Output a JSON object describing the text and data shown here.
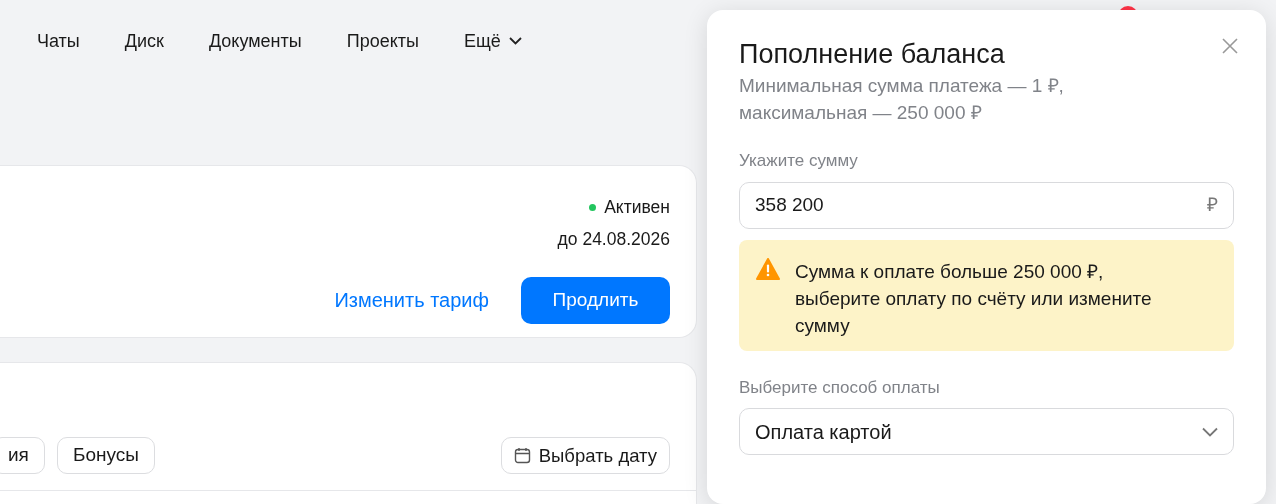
{
  "nav": {
    "items": [
      {
        "label": "Чаты",
        "kind": "link"
      },
      {
        "label": "Диск",
        "kind": "link"
      },
      {
        "label": "Документы",
        "kind": "link"
      },
      {
        "label": "Проекты",
        "kind": "link"
      },
      {
        "label": "Ещё",
        "kind": "dropdown"
      }
    ]
  },
  "subscription": {
    "status": "Активен",
    "valid_until": "до 24.08.2026",
    "change_link": "Изменить тариф",
    "renew_button": "Продлить"
  },
  "history": {
    "filters": [
      {
        "label": "ия",
        "selected": false
      },
      {
        "label": "Бонусы",
        "selected": false
      }
    ],
    "date_button": "Выбрать дату"
  },
  "top_up_dialog": {
    "title": "Пополнение баланса",
    "subtitle": "Минимальная сумма платежа — 1 ₽, максимальная — 250 000 ₽",
    "amount": {
      "label": "Укажите сумму",
      "value": "358 200",
      "currency": "₽"
    },
    "warning": "Сумма к оплате больше 250 000 ₽, выберите оплату по счёту или измените сумму",
    "payment_method": {
      "label": "Выберите способ оплаты",
      "value": "Оплата картой"
    }
  }
}
